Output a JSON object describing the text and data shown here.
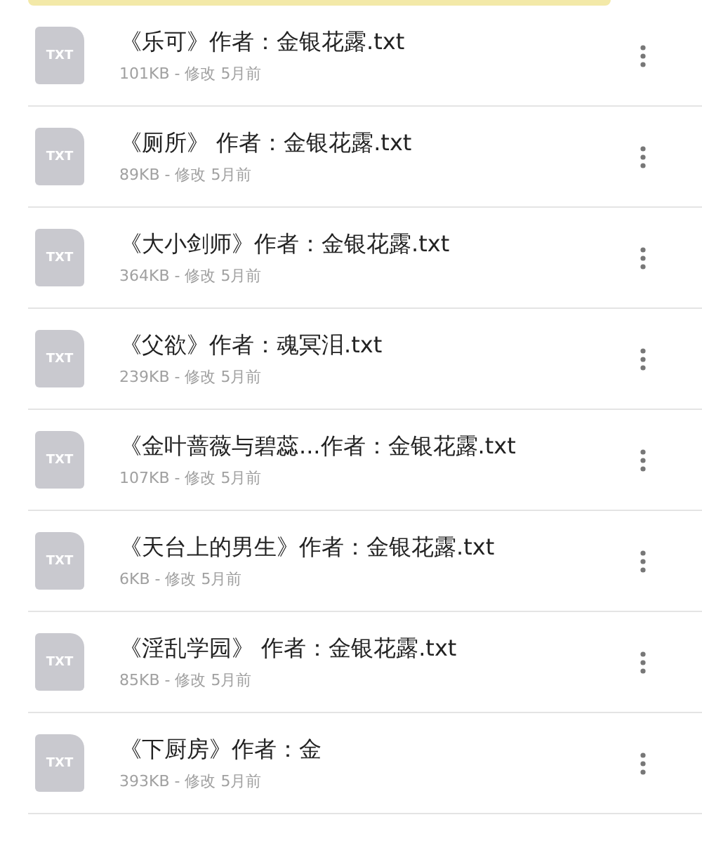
{
  "files": [
    {
      "name": "《乐可》作者：金银花露.txt",
      "meta": "101KB - 修改 5月前",
      "icon_label": "TXT"
    },
    {
      "name": "《厕所》 作者：金银花露.txt",
      "meta": "89KB - 修改 5月前",
      "icon_label": "TXT"
    },
    {
      "name": "《大小剑师》作者：金银花露.txt",
      "meta": "364KB - 修改 5月前",
      "icon_label": "TXT"
    },
    {
      "name": "《父欲》作者：魂冥泪.txt",
      "meta": "239KB - 修改 5月前",
      "icon_label": "TXT"
    },
    {
      "name": "《金叶蔷薇与碧蕊...作者：金银花露.txt",
      "meta": "107KB - 修改 5月前",
      "icon_label": "TXT"
    },
    {
      "name": "《天台上的男生》作者：金银花露.txt",
      "meta": "6KB - 修改 5月前",
      "icon_label": "TXT"
    },
    {
      "name": "《淫乱学园》 作者：金银花露.txt",
      "meta": "85KB - 修改 5月前",
      "icon_label": "TXT"
    },
    {
      "name": "《下厨房》作者：金",
      "meta": "393KB - 修改 5月前",
      "icon_label": "TXT"
    }
  ]
}
